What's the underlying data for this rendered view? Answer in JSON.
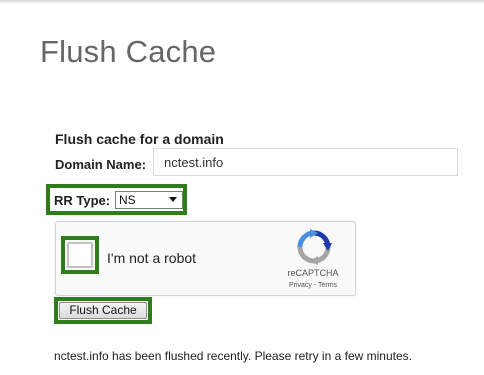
{
  "page": {
    "title": "Flush Cache"
  },
  "form": {
    "section_title": "Flush cache for a domain",
    "domain_label": "Domain Name:",
    "domain_value": "nctest.info",
    "rr_type_label": "RR Type:",
    "rr_type_value": "NS",
    "submit_label": "Flush Cache"
  },
  "captcha": {
    "label": "I'm not a robot",
    "brand": "reCAPTCHA",
    "privacy": "Privacy",
    "separator": " - ",
    "terms": "Terms"
  },
  "status": {
    "message": "nctest.info has been flushed recently. Please retry in a few minutes."
  },
  "colors": {
    "highlight": "#2d7d1c",
    "title": "#666666",
    "recaptcha_blue": "#4a90e2",
    "recaptcha_dark_blue": "#1c3aa9",
    "recaptcha_gray": "#a6a6a6"
  },
  "icons": {
    "recaptcha": "recaptcha-logo-icon",
    "dropdown": "chevron-down-icon"
  }
}
